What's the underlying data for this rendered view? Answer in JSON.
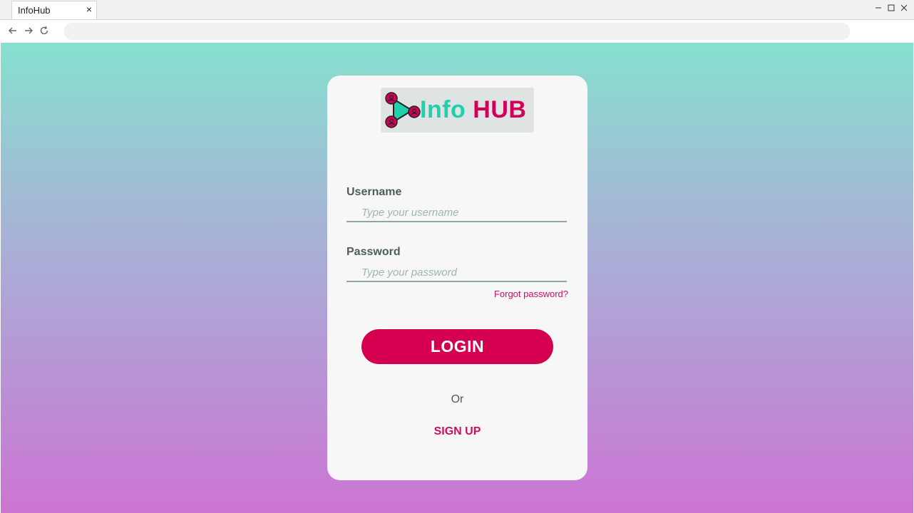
{
  "browser": {
    "tab_title": "InfoHub",
    "tab_close": "×",
    "address_value": ""
  },
  "logo": {
    "word_info": "Info",
    "word_hub": "HUB",
    "accent_teal": "#1fd0ac",
    "accent_pink": "#d0005a"
  },
  "login": {
    "username_label": "Username",
    "username_placeholder": "Type your username",
    "password_label": "Password",
    "password_placeholder": "Type your password",
    "forgot_label": "Forgot password?",
    "login_button": "LOGIN",
    "or_text": "Or",
    "signup_label": "SIGN UP"
  },
  "colors": {
    "primary": "#d4004f",
    "gradient_top": "#86e0cf",
    "gradient_bottom": "#cd74d3"
  }
}
